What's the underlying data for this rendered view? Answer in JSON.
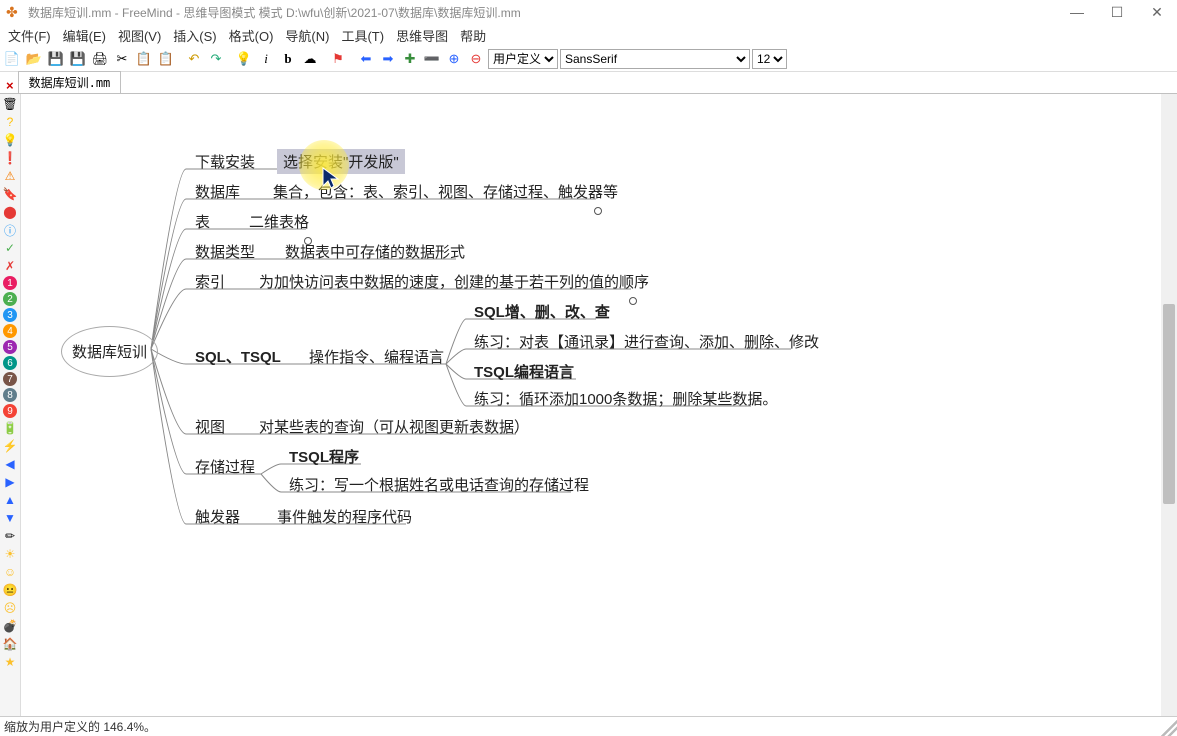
{
  "title": "数据库短训.mm - FreeMind - 思维导图模式 模式 D:\\wfu\\创新\\2021-07\\数据库\\数据库短训.mm",
  "menu": [
    "文件(F)",
    "编辑(E)",
    "视图(V)",
    "插入(S)",
    "格式(O)",
    "导航(N)",
    "工具(T)",
    "思维导图",
    "帮助"
  ],
  "tab_label": "数据库短训.mm",
  "user_def": "用户定义.",
  "font": "SansSerif",
  "fontsize": "12",
  "status": "缩放为用户定义的 146.4%。",
  "mindmap": {
    "root": "数据库短训",
    "l1": {
      "download": "下载安装",
      "database": "数据库",
      "table": "表",
      "datatype": "数据类型",
      "index": "索引",
      "sql": "SQL、TSQL",
      "view": "视图",
      "proc": "存储过程",
      "trigger": "触发器"
    },
    "l2": {
      "download_sel": "选择安装\"开发版\"",
      "db_set": "集合，包含：表、索引、视图、存储过程、触发器等",
      "table2d": "二维表格",
      "dtype_desc": "数据表中可存储的数据形式",
      "index_desc": "为加快访问表中数据的速度，创建的基于若干列的值的顺序",
      "sql_desc": "操作指令、编程语言",
      "view_desc": "对某些表的查询（可从视图更新表数据）",
      "trigger_desc": "事件触发的程序代码"
    },
    "l3": {
      "sql_crud": "SQL增、删、改、查",
      "sql_ex1": "练习：对表【通讯录】进行查询、添加、删除、修改",
      "tsql_lang": "TSQL编程语言",
      "tsql_ex": "练习：循环添加1000条数据；删除某些数据。",
      "proc_tsql": "TSQL程序",
      "proc_ex": "练习：写一个根据姓名或电话查询的存储过程"
    }
  }
}
